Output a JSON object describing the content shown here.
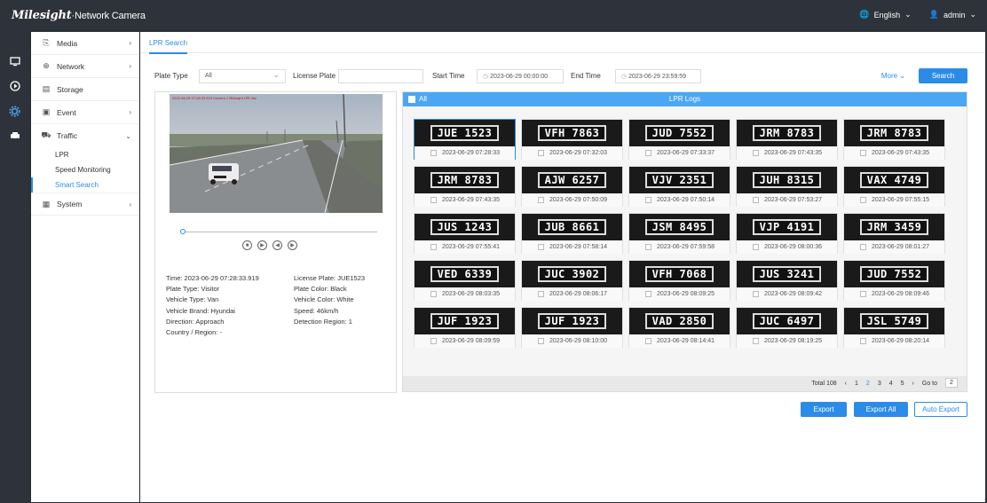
{
  "header": {
    "brand": "Milesight",
    "product": "·Network Camera",
    "language": "English",
    "user": "admin"
  },
  "sidebar": {
    "items": [
      {
        "label": "Media",
        "icon": "media-icon",
        "has_children": true
      },
      {
        "label": "Network",
        "icon": "globe-icon",
        "has_children": true
      },
      {
        "label": "Storage",
        "icon": "storage-icon",
        "has_children": false
      },
      {
        "label": "Event",
        "icon": "event-icon",
        "has_children": true
      },
      {
        "label": "Traffic",
        "icon": "car-icon",
        "has_children": true,
        "expanded": true
      },
      {
        "label": "System",
        "icon": "system-icon",
        "has_children": true
      }
    ],
    "traffic_sub": [
      "LPR",
      "Speed Monitoring",
      "Smart Search"
    ],
    "active_sub": "Smart Search"
  },
  "tab": {
    "label": "LPR Search"
  },
  "filter": {
    "plate_type_label": "Plate Type",
    "plate_type_value": "All",
    "license_plate_label": "License Plate",
    "license_plate_value": "",
    "start_time_label": "Start Time",
    "start_time_value": "2023-06-29 00:00:00",
    "end_time_label": "End Time",
    "end_time_value": "2023-06-29 23:59:59",
    "more_label": "More",
    "search_label": "Search"
  },
  "video_overlay": "2023-06-29 07:28:33.919 Camera 1 Milesight LPR Van",
  "details": {
    "left": [
      "Time: 2023-06-29 07:28:33.919",
      "Plate Type: Visitor",
      "Vehicle Type: Van",
      "Vehicle Brand: Hyundai",
      "Direction: Approach",
      "Country / Region: -"
    ],
    "right": [
      "License Plate: JUE1523",
      "Plate Color: Black",
      "Vehicle Color: White",
      "Speed: 46km/h",
      "Detection Region: 1"
    ]
  },
  "logs": {
    "all_label": "All",
    "title": "LPR Logs",
    "cards": [
      {
        "plate": "JUE 1523",
        "time": "2023-06-29 07:28:33",
        "selected": true
      },
      {
        "plate": "VFH 7863",
        "time": "2023-06-29 07:32:03"
      },
      {
        "plate": "JUD 7552",
        "time": "2023-06-29 07:33:37"
      },
      {
        "plate": "JRM 8783",
        "time": "2023-06-29 07:43:35"
      },
      {
        "plate": "JRM 8783",
        "time": "2023-06-29 07:43:35"
      },
      {
        "plate": "JRM 8783",
        "time": "2023-06-29 07:43:35"
      },
      {
        "plate": "AJW 6257",
        "time": "2023-06-29 07:50:09"
      },
      {
        "plate": "VJV 2351",
        "time": "2023-06-29 07:50:14"
      },
      {
        "plate": "JUH 8315",
        "time": "2023-06-29 07:53:27"
      },
      {
        "plate": "VAX 4749",
        "time": "2023-06-29 07:55:15"
      },
      {
        "plate": "JUS 1243",
        "time": "2023-06-29 07:55:41"
      },
      {
        "plate": "JUB 8661",
        "time": "2023-06-29 07:58:14"
      },
      {
        "plate": "JSM 8495",
        "time": "2023-06-29 07:59:58"
      },
      {
        "plate": "VJP 4191",
        "time": "2023-06-29 08:00:36"
      },
      {
        "plate": "JRM 3459",
        "time": "2023-06-29 08:01:27"
      },
      {
        "plate": "VED 6339",
        "time": "2023-06-29 08:03:35"
      },
      {
        "plate": "JUC 3902",
        "time": "2023-06-29 08:06:17"
      },
      {
        "plate": "VFH 7068",
        "time": "2023-06-29 08:09:25"
      },
      {
        "plate": "JUS 3241",
        "time": "2023-06-29 08:09:42"
      },
      {
        "plate": "JUD 7552",
        "time": "2023-06-29 08:09:46"
      },
      {
        "plate": "JUF 1923",
        "time": "2023-06-29 08:09:59"
      },
      {
        "plate": "JUF 1923",
        "time": "2023-06-29 08:10:00"
      },
      {
        "plate": "VAD 2850",
        "time": "2023-06-29 08:14:41"
      },
      {
        "plate": "JUC 6497",
        "time": "2023-06-29 08:19:25"
      },
      {
        "plate": "JSL 5749",
        "time": "2023-06-29 08:20:14"
      }
    ]
  },
  "pager": {
    "total": "Total 108",
    "prev": "‹",
    "pages": [
      "1",
      "2",
      "3",
      "4",
      "5"
    ],
    "active_page": "2",
    "next": "›",
    "goto_label": "Go to",
    "goto_value": "2"
  },
  "actions": {
    "export": "Export",
    "export_all": "Export All",
    "auto_export": "Auto Export"
  },
  "colors": {
    "accent": "#2b8ce8",
    "header": "#4ba7f4",
    "topbar": "#2e323a"
  }
}
